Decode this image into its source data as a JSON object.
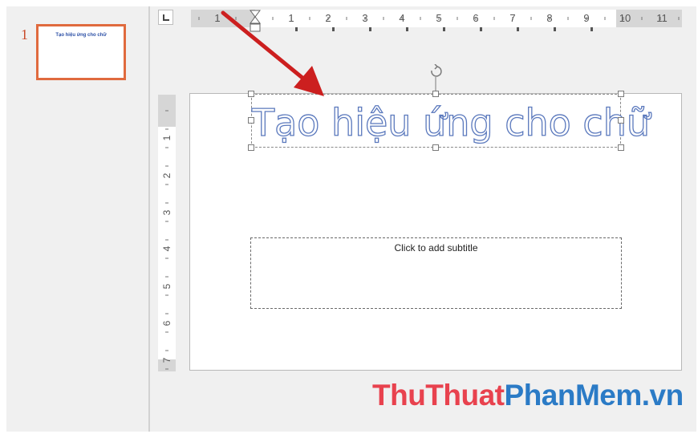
{
  "thumbnails": [
    {
      "number": "1",
      "title": "Tạo hiệu ứng cho chữ"
    }
  ],
  "ruler": {
    "horizontal_labels": [
      "1",
      "1",
      "2",
      "3",
      "4",
      "5",
      "6",
      "7",
      "8",
      "9",
      "10",
      "11"
    ],
    "vertical_labels": [
      "1",
      "2",
      "3",
      "4",
      "5",
      "6",
      "7"
    ]
  },
  "slide": {
    "title": "Tạo hiệu ứng cho chữ",
    "subtitle_placeholder": "Click to add subtitle"
  },
  "watermark": {
    "part1": "ThuThuat",
    "part2": "PhanMem.vn"
  },
  "colors": {
    "thumbnail_border": "#e06a3e",
    "title_outline": "#5b79bd",
    "arrow": "#cc1f1f",
    "watermark_red": "#e8424e",
    "watermark_blue": "#2b7bc6"
  },
  "icons": [
    "tab-stop-icon",
    "indent-marker-icon",
    "rotate-handle-icon",
    "red-arrow-annotation"
  ]
}
